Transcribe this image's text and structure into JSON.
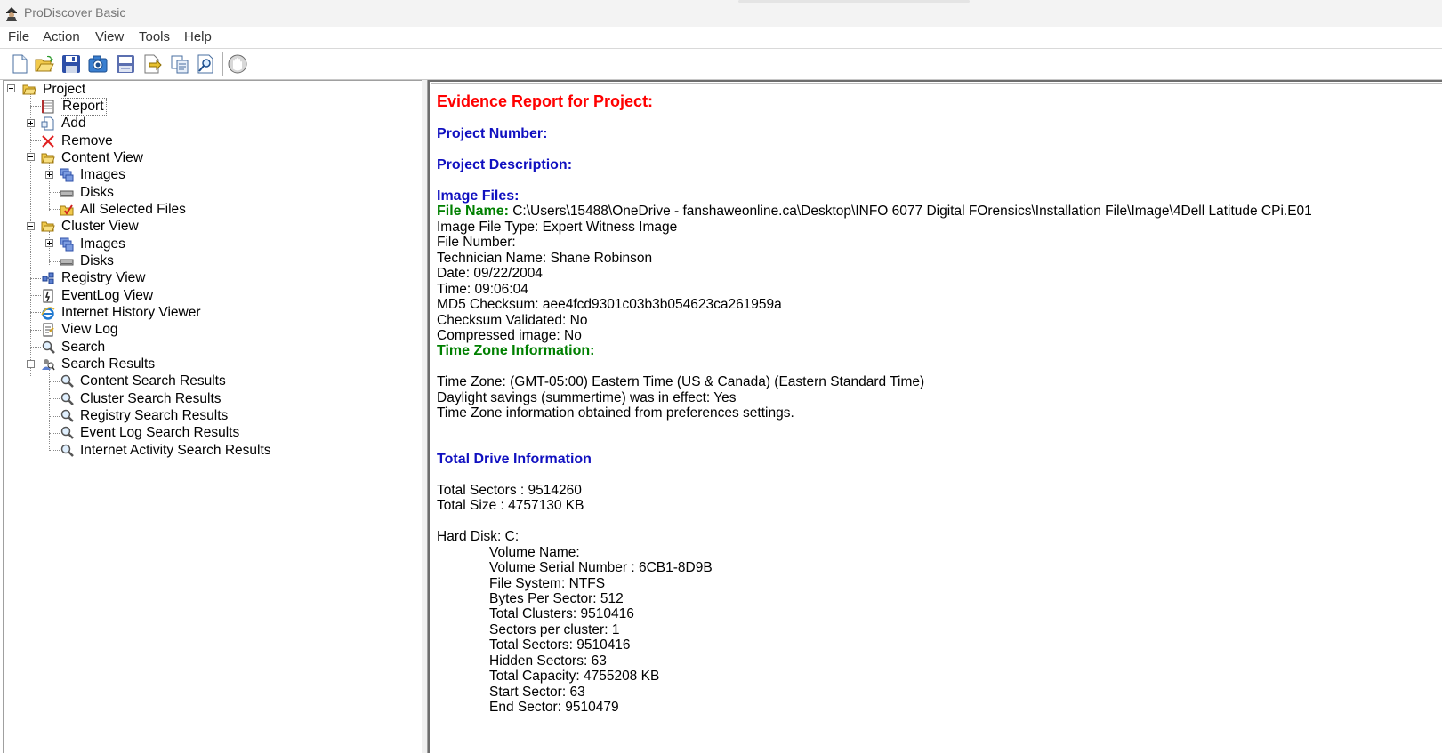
{
  "window": {
    "title": "ProDiscover Basic"
  },
  "menu": [
    "File",
    "Action",
    "View",
    "Tools",
    "Help"
  ],
  "toolbar": {
    "buttons": [
      "new-project-icon",
      "open-project-icon",
      "save-icon",
      "capture-image-icon",
      "save-report-icon",
      "add-file-icon",
      "copy-icon",
      "search-icon",
      "stop-icon"
    ]
  },
  "tree": {
    "project": "Project",
    "report": "Report",
    "add": "Add",
    "remove": "Remove",
    "content_view": "Content View",
    "cv_images": "Images",
    "cv_disks": "Disks",
    "cv_all_selected": "All Selected Files",
    "cluster_view": "Cluster View",
    "cl_images": "Images",
    "cl_disks": "Disks",
    "registry_view": "Registry View",
    "eventlog_view": "EventLog View",
    "internet_history": "Internet History Viewer",
    "view_log": "View Log",
    "search": "Search",
    "search_results": "Search Results",
    "content_search": "Content Search Results",
    "cluster_search": "Cluster Search Results",
    "registry_search": "Registry Search Results",
    "eventlog_search": "Event Log Search Results",
    "internet_search": "Internet Activity Search Results"
  },
  "report": {
    "title": "Evidence Report for Project:",
    "project_number": "Project Number:",
    "project_description": "Project Description:",
    "image_files": "Image Files:",
    "file_name_label": "File Name:",
    "file_name_value": " C:\\Users\\15488\\OneDrive - fanshaweonline.ca\\Desktop\\INFO 6077 Digital FOrensics\\Installation File\\Image\\4Dell Latitude CPi.E01",
    "image_file_type": "Image File Type: Expert Witness Image",
    "file_number": "File Number:",
    "technician": "Technician Name: Shane Robinson",
    "date": "Date: 09/22/2004",
    "time": "Time: 09:06:04",
    "md5": "MD5 Checksum: aee4fcd9301c03b3b054623ca261959a",
    "checksum_validated": "Checksum Validated: No",
    "compressed": "Compressed image: No",
    "tz_heading": "Time Zone Information:",
    "tz_zone": "Time Zone: (GMT-05:00) Eastern Time (US & Canada) (Eastern Standard Time)",
    "tz_dst": "Daylight savings (summertime) was in effect: Yes",
    "tz_source": "Time Zone information obtained from preferences settings.",
    "drive_heading": "Total Drive Information",
    "total_sectors": "Total Sectors : 9514260",
    "total_size": "Total Size : 4757130 KB",
    "hard_disk": "Hard Disk: C:",
    "volume_name": "Volume Name:",
    "volume_serial": "Volume Serial Number : 6CB1-8D9B",
    "file_system": "File System: NTFS",
    "bytes_per_sector": "Bytes Per Sector: 512",
    "total_clusters": "Total Clusters: 9510416",
    "sectors_per_cluster": "Sectors per cluster: 1",
    "vol_total_sectors": "Total Sectors: 9510416",
    "hidden_sectors": "Hidden Sectors: 63",
    "total_capacity": "Total Capacity: 4755208 KB",
    "start_sector": "Start Sector: 63",
    "end_sector": "End Sector: 9510479"
  },
  "colors": {
    "report_title": "#ff0000",
    "heading_blue": "#1010c0",
    "heading_green": "#008000"
  }
}
